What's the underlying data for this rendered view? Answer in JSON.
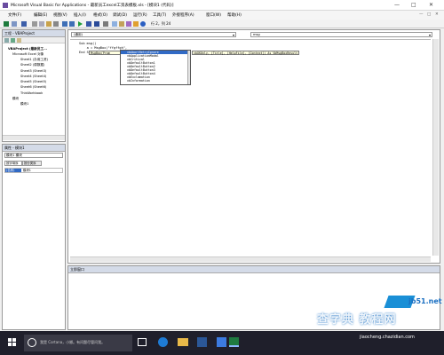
{
  "window": {
    "title": "Microsoft Visual Basic for Applications - 最新员工excel工资表模板.xls - [模块1 (代码)]",
    "controls": [
      "—",
      "□",
      "✕"
    ],
    "inner_controls": [
      "—",
      "□",
      "✕"
    ]
  },
  "menu": [
    "文件(F)",
    "编辑(E)",
    "视图(V)",
    "插入(I)",
    "格式(O)",
    "调试(D)",
    "运行(R)",
    "工具(T)",
    "外接程序(A)",
    "窗口(W)",
    "帮助(H)"
  ],
  "toolbar": {
    "position": "行 2，列 24"
  },
  "project_pane": {
    "title": "工程 - VBAProject",
    "tree": [
      "VBAProject (最新员工...",
      "Microsoft Excel 对象",
      "Sheet1 (办用工资)",
      "Sheet2 (原数据)",
      "Sheet3 (Sheet3)",
      "Sheet4 (Sheet4)",
      "Sheet5 (Sheet5)",
      "Sheet6 (Sheet6)",
      "ThisWorkbook",
      "模块",
      "模块1"
    ]
  },
  "props_pane": {
    "title": "属性 - 模块1",
    "combo": "模块1 模块",
    "tabs": [
      "按字母序",
      "按分类序"
    ],
    "row_name": "(名称)",
    "row_value": "模块1"
  },
  "code_window": {
    "object_combo": "(通用)",
    "proc_combo": "msg",
    "lines": [
      "Sub msg()",
      "    a = MsgBox(\"ffgffgh\", ",
      "End Sub"
    ],
    "tooltip": "MsgBox(Prom",
    "quickinfo": "vbOKOnly, [Title], [HelpFile], [Context]) As VbMsgBoxResult",
    "autocomplete": [
      "vbAbortRetryIgnore",
      "vbApplicationModal",
      "vbCritical",
      "vbDefaultButton1",
      "vbDefaultButton2",
      "vbDefaultButton3",
      "vbDefaultButton4",
      "vbExclamation",
      "vbInformation"
    ]
  },
  "immediate": {
    "title": "立即窗口"
  },
  "taskbar": {
    "search": "我是 Cortana，小娜。有问题尽管问我。",
    "time": ""
  },
  "watermark": {
    "main": "查字典 教程网",
    "site": "jiaocheng.chazidian.com",
    "site2": "jb51.net"
  }
}
